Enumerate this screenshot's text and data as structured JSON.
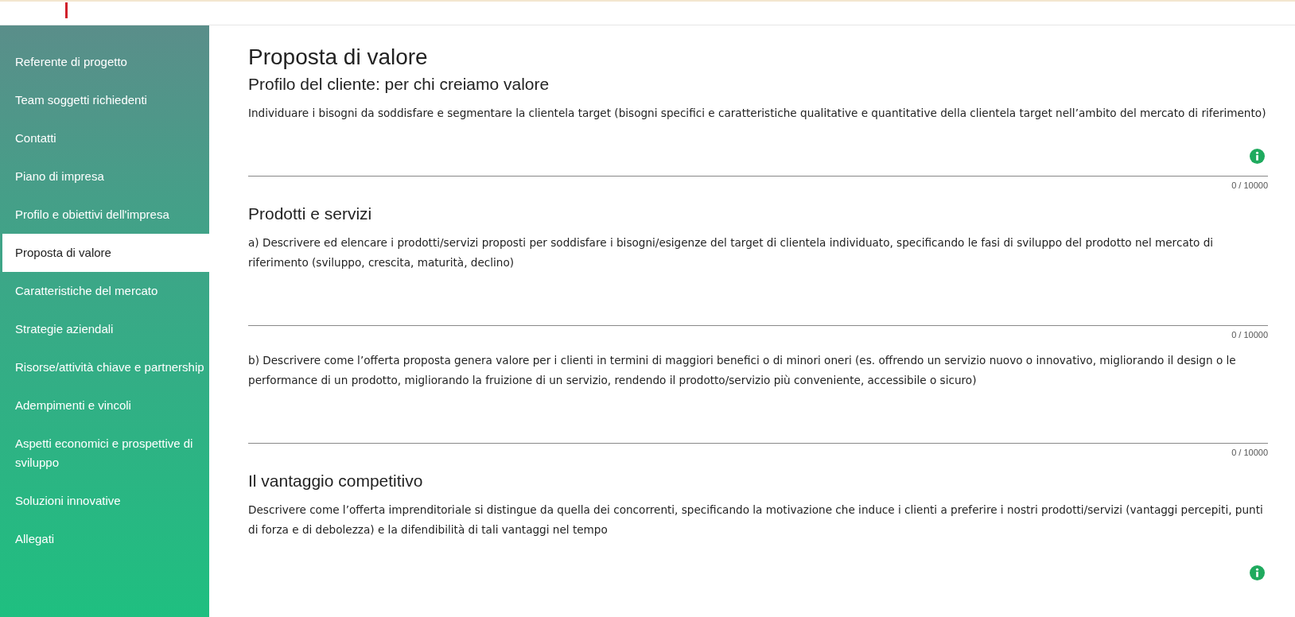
{
  "sidebar": {
    "items": [
      {
        "label": "Referente di progetto",
        "selected": false
      },
      {
        "label": "Team soggetti richiedenti",
        "selected": false
      },
      {
        "label": "Contatti",
        "selected": false
      },
      {
        "label": "Piano di impresa",
        "selected": false
      },
      {
        "label": "Profilo e obiettivi dell'impresa",
        "selected": false
      },
      {
        "label": "Proposta di valore",
        "selected": true
      },
      {
        "label": "Caratteristiche del mercato",
        "selected": false
      },
      {
        "label": "Strategie aziendali",
        "selected": false
      },
      {
        "label": "Risorse/attività chiave e partnership",
        "selected": false
      },
      {
        "label": "Adempimenti e vincoli",
        "selected": false
      },
      {
        "label": "Aspetti economici e prospettive di sviluppo",
        "selected": false
      },
      {
        "label": "Soluzioni innovative",
        "selected": false
      },
      {
        "label": "Allegati",
        "selected": false
      }
    ]
  },
  "page_title": "Proposta di valore",
  "sections": [
    {
      "title": "Profilo del cliente: per chi creiamo valore",
      "fields": [
        {
          "description": "Individuare i bisogni da soddisfare e segmentare la clientela target (bisogni specifici e caratteristiche qualitative e quantitative della clientela target nell’ambito del mercato di riferimento)",
          "info": true,
          "counter": "0 / 10000"
        }
      ]
    },
    {
      "title": "Prodotti e servizi",
      "fields": [
        {
          "description": "a) Descrivere ed elencare i prodotti/servizi proposti per soddisfare i bisogni/esigenze del target di clientela individuato, specificando le fasi di sviluppo del prodotto nel mercato di riferimento (sviluppo, crescita, maturità, declino)",
          "info": false,
          "counter": "0 / 10000"
        },
        {
          "description": "b) Descrivere come l’offerta proposta genera valore per i clienti in termini di maggiori benefici o di minori oneri (es. offrendo un servizio nuovo o innovativo, migliorando il design o le performance di un prodotto, migliorando la fruizione di un servizio, rendendo il prodotto/servizio più conveniente, accessibile o sicuro)",
          "info": false,
          "counter": "0 / 10000"
        }
      ]
    },
    {
      "title": "Il vantaggio competitivo",
      "fields": [
        {
          "description": "Descrivere come l’offerta imprenditoriale si distingue da quella dei concorrenti, specificando la motivazione che induce i clienti a preferire i nostri prodotti/servizi (vantaggi percepiti, punti di forza e di debolezza) e la difendibilità di tali vantaggi nel tempo",
          "info": true
        }
      ]
    }
  ]
}
